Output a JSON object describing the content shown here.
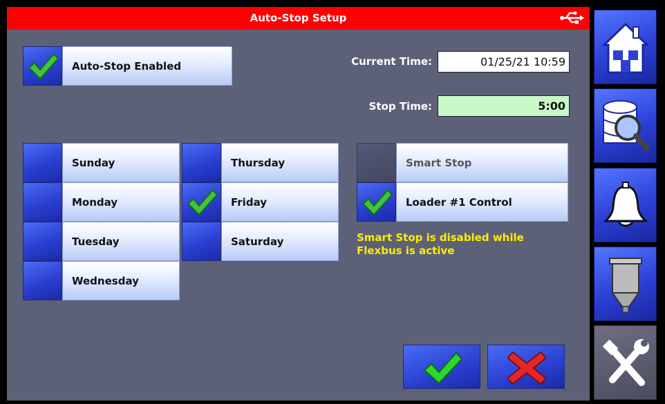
{
  "header": {
    "title": "Auto-Stop Setup",
    "usb_icon": "usb-icon"
  },
  "autostop": {
    "label": "Auto-Stop Enabled",
    "checked": true
  },
  "current_time": {
    "label": "Current Time:",
    "value": "01/25/21 10:59"
  },
  "stop_time": {
    "label": "Stop Time:",
    "value": "5:00"
  },
  "days": [
    {
      "label": "Sunday",
      "checked": false
    },
    {
      "label": "Monday",
      "checked": false
    },
    {
      "label": "Tuesday",
      "checked": false
    },
    {
      "label": "Wednesday",
      "checked": false
    },
    {
      "label": "Thursday",
      "checked": false
    },
    {
      "label": "Friday",
      "checked": true
    },
    {
      "label": "Saturday",
      "checked": false
    }
  ],
  "options": [
    {
      "label": "Smart Stop",
      "checked": false,
      "disabled": true
    },
    {
      "label": "Loader #1 Control",
      "checked": true,
      "disabled": false
    }
  ],
  "message": {
    "line1": "Smart Stop is disabled while",
    "line2": "Flexbus is active"
  },
  "footer": {
    "confirm_icon": "checkmark-icon",
    "cancel_icon": "x-icon"
  },
  "sidebar": {
    "items": [
      "home-icon",
      "database-search-icon",
      "bell-icon",
      "hopper-icon",
      "tools-icon"
    ]
  },
  "colors": {
    "title_bar": "#ff0000",
    "panel": "#5c6178",
    "warning_text": "#ffee00",
    "stop_time_field": "#c8f7c8"
  }
}
